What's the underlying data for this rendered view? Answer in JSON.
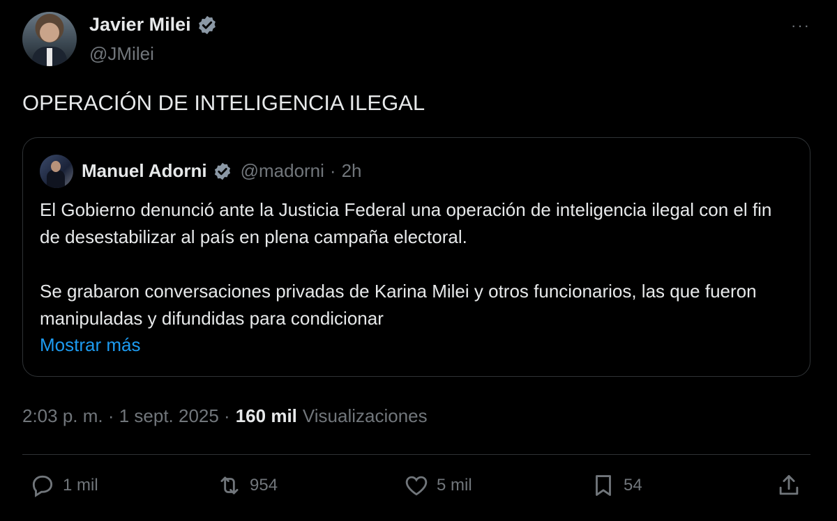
{
  "author": {
    "name": "Javier Milei",
    "handle": "@JMilei"
  },
  "tweet": {
    "text": "OPERACIÓN DE INTELIGENCIA ILEGAL",
    "more_label": "···"
  },
  "quoted": {
    "name": "Manuel Adorni",
    "handle": "@madorni",
    "separator": "·",
    "time": "2h",
    "paragraph1": "El Gobierno denunció ante la Justicia Federal una operación de inteligencia ilegal con el fin de desestabilizar al país en plena campaña electoral.",
    "paragraph2": "Se grabaron conversaciones privadas de Karina Milei y otros funcionarios, las que fueron manipuladas y difundidas para condicionar",
    "show_more": "Mostrar más"
  },
  "meta": {
    "timestamp": "2:03 p. m. · 1 sept. 2025 ·",
    "views_count": "160 mil",
    "views_label": "Visualizaciones"
  },
  "actions": {
    "replies": "1 mil",
    "reposts": "954",
    "likes": "5 mil",
    "bookmarks": "54"
  },
  "colors": {
    "background": "#000000",
    "text": "#e7e9ea",
    "muted": "#71767b",
    "link": "#1d9bf0",
    "verified": "#1d9bf0",
    "border": "#2f3336"
  }
}
